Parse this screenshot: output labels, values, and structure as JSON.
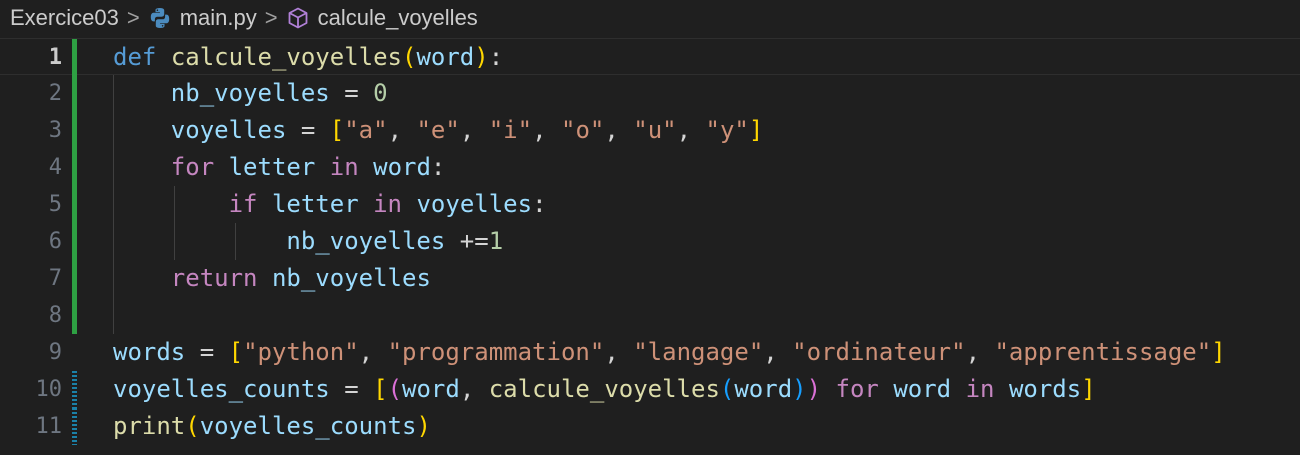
{
  "breadcrumb": {
    "folder": "Exercice03",
    "file": "main.py",
    "symbol": "calcule_voyelles",
    "separator": ">"
  },
  "icons": {
    "file_icon": "python-icon",
    "symbol_icon": "cube-icon",
    "separator_icon": "chevron-right-icon"
  },
  "colors": {
    "background": "#1f1f1f",
    "keyword_def": "#569cd6",
    "keyword_control": "#c586c0",
    "function": "#dcdcaa",
    "variable": "#9cdcfe",
    "number": "#b5cea8",
    "string": "#ce9178",
    "bracket_level_1": "#ffd700",
    "bracket_level_2": "#da70d6",
    "bracket_level_3": "#179fff",
    "git_added": "#2ea043",
    "git_modified": "#1b81a8"
  },
  "editor": {
    "active_line": 1,
    "lines": [
      {
        "number": "1",
        "gutter": "added",
        "tokens": [
          {
            "t": "def",
            "c": "kw-def"
          },
          {
            "t": " ",
            "c": "op"
          },
          {
            "t": "calcule_voyelles",
            "c": "fn"
          },
          {
            "t": "(",
            "c": "b1"
          },
          {
            "t": "word",
            "c": "var"
          },
          {
            "t": ")",
            "c": "b1"
          },
          {
            "t": ":",
            "c": "op"
          }
        ]
      },
      {
        "number": "2",
        "gutter": "added",
        "tokens": [
          {
            "t": "    ",
            "c": "op"
          },
          {
            "t": "nb_voyelles",
            "c": "var"
          },
          {
            "t": " = ",
            "c": "op"
          },
          {
            "t": "0",
            "c": "num"
          }
        ]
      },
      {
        "number": "3",
        "gutter": "added",
        "tokens": [
          {
            "t": "    ",
            "c": "op"
          },
          {
            "t": "voyelles",
            "c": "var"
          },
          {
            "t": " = ",
            "c": "op"
          },
          {
            "t": "[",
            "c": "b1"
          },
          {
            "t": "\"a\"",
            "c": "str"
          },
          {
            "t": ", ",
            "c": "op"
          },
          {
            "t": "\"e\"",
            "c": "str"
          },
          {
            "t": ", ",
            "c": "op"
          },
          {
            "t": "\"i\"",
            "c": "str"
          },
          {
            "t": ", ",
            "c": "op"
          },
          {
            "t": "\"o\"",
            "c": "str"
          },
          {
            "t": ", ",
            "c": "op"
          },
          {
            "t": "\"u\"",
            "c": "str"
          },
          {
            "t": ", ",
            "c": "op"
          },
          {
            "t": "\"y\"",
            "c": "str"
          },
          {
            "t": "]",
            "c": "b1"
          }
        ]
      },
      {
        "number": "4",
        "gutter": "added",
        "tokens": [
          {
            "t": "    ",
            "c": "op"
          },
          {
            "t": "for",
            "c": "kw-ctrl"
          },
          {
            "t": " ",
            "c": "op"
          },
          {
            "t": "letter",
            "c": "var"
          },
          {
            "t": " ",
            "c": "op"
          },
          {
            "t": "in",
            "c": "kw-ctrl"
          },
          {
            "t": " ",
            "c": "op"
          },
          {
            "t": "word",
            "c": "var"
          },
          {
            "t": ":",
            "c": "op"
          }
        ]
      },
      {
        "number": "5",
        "gutter": "added",
        "tokens": [
          {
            "t": "        ",
            "c": "op"
          },
          {
            "t": "if",
            "c": "kw-ctrl"
          },
          {
            "t": " ",
            "c": "op"
          },
          {
            "t": "letter",
            "c": "var"
          },
          {
            "t": " ",
            "c": "op"
          },
          {
            "t": "in",
            "c": "kw-ctrl"
          },
          {
            "t": " ",
            "c": "op"
          },
          {
            "t": "voyelles",
            "c": "var"
          },
          {
            "t": ":",
            "c": "op"
          }
        ]
      },
      {
        "number": "6",
        "gutter": "added",
        "tokens": [
          {
            "t": "            ",
            "c": "op"
          },
          {
            "t": "nb_voyelles",
            "c": "var"
          },
          {
            "t": " +=",
            "c": "op"
          },
          {
            "t": "1",
            "c": "num"
          }
        ]
      },
      {
        "number": "7",
        "gutter": "added",
        "tokens": [
          {
            "t": "    ",
            "c": "op"
          },
          {
            "t": "return",
            "c": "kw-ctrl"
          },
          {
            "t": " ",
            "c": "op"
          },
          {
            "t": "nb_voyelles",
            "c": "var"
          }
        ]
      },
      {
        "number": "8",
        "gutter": "added",
        "tokens": []
      },
      {
        "number": "9",
        "gutter": "none",
        "tokens": [
          {
            "t": "words",
            "c": "var"
          },
          {
            "t": " = ",
            "c": "op"
          },
          {
            "t": "[",
            "c": "b1"
          },
          {
            "t": "\"python\"",
            "c": "str"
          },
          {
            "t": ", ",
            "c": "op"
          },
          {
            "t": "\"programmation\"",
            "c": "str"
          },
          {
            "t": ", ",
            "c": "op"
          },
          {
            "t": "\"langage\"",
            "c": "str"
          },
          {
            "t": ", ",
            "c": "op"
          },
          {
            "t": "\"ordinateur\"",
            "c": "str"
          },
          {
            "t": ", ",
            "c": "op"
          },
          {
            "t": "\"apprentissage\"",
            "c": "str"
          },
          {
            "t": "]",
            "c": "b1"
          }
        ]
      },
      {
        "number": "10",
        "gutter": "modified",
        "tokens": [
          {
            "t": "voyelles_counts",
            "c": "var"
          },
          {
            "t": " = ",
            "c": "op"
          },
          {
            "t": "[",
            "c": "b1"
          },
          {
            "t": "(",
            "c": "b2"
          },
          {
            "t": "word",
            "c": "var"
          },
          {
            "t": ", ",
            "c": "op"
          },
          {
            "t": "calcule_voyelles",
            "c": "fn"
          },
          {
            "t": "(",
            "c": "b3"
          },
          {
            "t": "word",
            "c": "var"
          },
          {
            "t": ")",
            "c": "b3"
          },
          {
            "t": ")",
            "c": "b2"
          },
          {
            "t": " ",
            "c": "op"
          },
          {
            "t": "for",
            "c": "kw-ctrl"
          },
          {
            "t": " ",
            "c": "op"
          },
          {
            "t": "word",
            "c": "var"
          },
          {
            "t": " ",
            "c": "op"
          },
          {
            "t": "in",
            "c": "kw-ctrl"
          },
          {
            "t": " ",
            "c": "op"
          },
          {
            "t": "words",
            "c": "var"
          },
          {
            "t": "]",
            "c": "b1"
          }
        ]
      },
      {
        "number": "11",
        "gutter": "modified",
        "tokens": [
          {
            "t": "print",
            "c": "fn"
          },
          {
            "t": "(",
            "c": "b1"
          },
          {
            "t": "voyelles_counts",
            "c": "var"
          },
          {
            "t": ")",
            "c": "b1"
          }
        ]
      }
    ]
  }
}
